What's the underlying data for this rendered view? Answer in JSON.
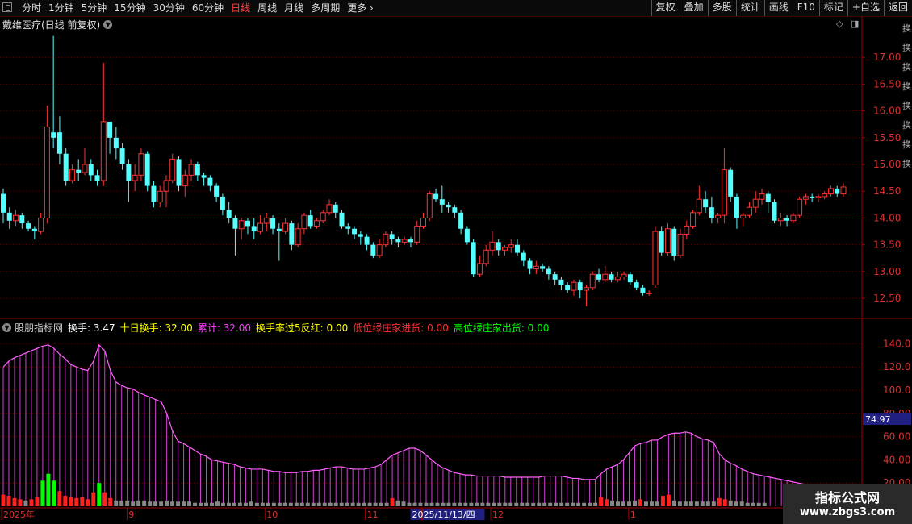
{
  "toolbar": {
    "periods": [
      "分时",
      "1分钟",
      "5分钟",
      "15分钟",
      "30分钟",
      "60分钟",
      "日线",
      "周线",
      "月线",
      "多周期",
      "更多 ›"
    ],
    "active_period": "日线",
    "buttons": [
      "复权",
      "叠加",
      "多股",
      "统计",
      "画线",
      "F10",
      "标记",
      "+自选",
      "返回"
    ]
  },
  "main": {
    "title": "戴维医疗(日线 前复权)",
    "price_ticks": [
      "17.00",
      "16.50",
      "16.00",
      "15.50",
      "15.00",
      "14.50",
      "14.00",
      "13.50",
      "13.00",
      "12.50"
    ]
  },
  "indicator": {
    "name": "股朋指标网",
    "items": [
      {
        "label": "换手: 3.47",
        "color": "#ffffff"
      },
      {
        "label": "十日换手: 32.00",
        "color": "#ffff00"
      },
      {
        "label": "累计: 32.00",
        "color": "#ff40ff"
      },
      {
        "label": "换手率过5反红: 0.00",
        "color": "#ffff00"
      },
      {
        "label": "低位绿庄家进货: 0.00",
        "color": "#ff3030"
      },
      {
        "label": "高位绿庄家出货: 0.00",
        "color": "#00ff00"
      }
    ],
    "ticks": [
      "140.0",
      "120.0",
      "100.0",
      "80.00",
      "60.00",
      "40.00",
      "20.00"
    ],
    "current_value": "74.97"
  },
  "date_axis": {
    "labels": [
      {
        "text": "2025年",
        "i": 0
      },
      {
        "text": "9",
        "i": 20
      },
      {
        "text": "10",
        "i": 42
      },
      {
        "text": "11",
        "i": 58
      },
      {
        "text": "2025/11/13/四",
        "i": 67,
        "highlight": true
      },
      {
        "text": "12",
        "i": 78
      },
      {
        "text": "1",
        "i": 100
      }
    ]
  },
  "side_chars": "换换换换换换换换",
  "watermark": {
    "line1": "指标公式网",
    "line2": "www.zbgs3.com"
  },
  "chart_data": {
    "type": "candlestick",
    "title": "戴维医疗(日线 前复权)",
    "ylim": [
      12.2,
      17.5
    ],
    "up_color": "#ff3232",
    "down_color": "#54ffff",
    "candles": [
      [
        14.45,
        14.1,
        14.55,
        13.9
      ],
      [
        14.1,
        13.95,
        14.2,
        13.8
      ],
      [
        13.95,
        14.05,
        14.15,
        13.85
      ],
      [
        14.05,
        13.9,
        14.1,
        13.8
      ],
      [
        13.9,
        13.8,
        13.95,
        13.75
      ],
      [
        13.8,
        13.75,
        13.85,
        13.6
      ],
      [
        13.75,
        14.0,
        14.1,
        13.7
      ],
      [
        14.0,
        15.7,
        16.1,
        13.9
      ],
      [
        15.6,
        15.5,
        17.4,
        15.3
      ],
      [
        15.6,
        15.2,
        15.9,
        15.0
      ],
      [
        15.2,
        14.7,
        15.3,
        14.6
      ],
      [
        14.7,
        14.9,
        15.0,
        14.65
      ],
      [
        14.9,
        14.85,
        15.1,
        14.7
      ],
      [
        14.85,
        15.0,
        15.3,
        14.8
      ],
      [
        15.0,
        14.8,
        15.1,
        14.7
      ],
      [
        14.8,
        14.7,
        14.9,
        14.6
      ],
      [
        14.7,
        15.8,
        16.9,
        14.6
      ],
      [
        15.8,
        15.5,
        15.6,
        15.2
      ],
      [
        15.5,
        15.3,
        15.7,
        15.1
      ],
      [
        15.3,
        15.0,
        15.4,
        14.9
      ],
      [
        15.0,
        14.7,
        15.1,
        14.3
      ],
      [
        14.7,
        14.8,
        15.0,
        14.5
      ],
      [
        14.8,
        15.2,
        15.3,
        14.7
      ],
      [
        15.2,
        14.6,
        15.25,
        14.5
      ],
      [
        14.6,
        14.3,
        14.7,
        14.2
      ],
      [
        14.3,
        14.5,
        14.6,
        14.2
      ],
      [
        14.5,
        14.7,
        14.8,
        14.2
      ],
      [
        14.7,
        15.1,
        15.2,
        14.65
      ],
      [
        15.1,
        14.6,
        15.15,
        14.5
      ],
      [
        14.6,
        14.8,
        14.9,
        14.4
      ],
      [
        14.8,
        15.0,
        15.1,
        14.7
      ],
      [
        15.0,
        14.8,
        15.05,
        14.7
      ],
      [
        14.8,
        14.75,
        14.85,
        14.6
      ],
      [
        14.75,
        14.6,
        14.8,
        14.5
      ],
      [
        14.6,
        14.4,
        14.65,
        14.3
      ],
      [
        14.4,
        14.15,
        14.45,
        14.05
      ],
      [
        14.15,
        14.0,
        14.3,
        13.9
      ],
      [
        14.0,
        13.8,
        14.05,
        13.3
      ],
      [
        13.8,
        13.95,
        14.0,
        13.6
      ],
      [
        13.95,
        13.85,
        14.0,
        13.7
      ],
      [
        13.85,
        13.75,
        14.0,
        13.6
      ],
      [
        13.75,
        13.9,
        14.05,
        13.7
      ],
      [
        13.9,
        14.0,
        14.1,
        13.75
      ],
      [
        14.0,
        13.8,
        14.05,
        13.7
      ],
      [
        13.8,
        13.75,
        13.9,
        13.2
      ],
      [
        13.75,
        13.9,
        14.0,
        13.7
      ],
      [
        13.9,
        13.5,
        13.95,
        13.4
      ],
      [
        13.5,
        13.8,
        13.9,
        13.45
      ],
      [
        13.8,
        14.05,
        14.1,
        13.7
      ],
      [
        14.05,
        13.85,
        14.15,
        13.8
      ],
      [
        13.85,
        13.95,
        14.0,
        13.8
      ],
      [
        13.95,
        14.1,
        14.15,
        13.9
      ],
      [
        14.1,
        14.25,
        14.35,
        14.05
      ],
      [
        14.25,
        14.1,
        14.3,
        14.0
      ],
      [
        14.1,
        13.85,
        14.15,
        13.8
      ],
      [
        13.85,
        13.8,
        13.9,
        13.7
      ],
      [
        13.8,
        13.7,
        13.85,
        13.6
      ],
      [
        13.7,
        13.65,
        13.75,
        13.5
      ],
      [
        13.65,
        13.5,
        13.7,
        13.4
      ],
      [
        13.5,
        13.3,
        13.55,
        13.25
      ],
      [
        13.3,
        13.5,
        13.6,
        13.25
      ],
      [
        13.5,
        13.7,
        13.75,
        13.45
      ],
      [
        13.7,
        13.6,
        13.75,
        13.5
      ],
      [
        13.6,
        13.55,
        13.65,
        13.45
      ],
      [
        13.55,
        13.6,
        13.65,
        13.5
      ],
      [
        13.6,
        13.55,
        13.65,
        13.45
      ],
      [
        13.55,
        13.85,
        13.95,
        13.5
      ],
      [
        13.85,
        14.0,
        14.1,
        13.8
      ],
      [
        14.0,
        14.45,
        14.5,
        13.95
      ],
      [
        14.45,
        14.35,
        14.55,
        14.3
      ],
      [
        14.35,
        14.25,
        14.6,
        14.1
      ],
      [
        14.25,
        14.2,
        14.3,
        14.1
      ],
      [
        14.2,
        14.1,
        14.25,
        14.0
      ],
      [
        14.1,
        13.8,
        14.15,
        13.7
      ],
      [
        13.8,
        13.55,
        13.85,
        13.5
      ],
      [
        13.55,
        12.95,
        13.6,
        12.9
      ],
      [
        12.95,
        13.15,
        13.3,
        12.9
      ],
      [
        13.15,
        13.4,
        13.5,
        13.1
      ],
      [
        13.4,
        13.55,
        13.75,
        13.3
      ],
      [
        13.55,
        13.4,
        13.6,
        13.3
      ],
      [
        13.4,
        13.45,
        13.5,
        13.3
      ],
      [
        13.45,
        13.5,
        13.6,
        13.35
      ],
      [
        13.5,
        13.35,
        13.6,
        13.3
      ],
      [
        13.35,
        13.2,
        13.4,
        13.1
      ],
      [
        13.2,
        13.05,
        13.25,
        12.95
      ],
      [
        13.05,
        13.1,
        13.2,
        12.95
      ],
      [
        13.1,
        13.05,
        13.15,
        13.0
      ],
      [
        13.05,
        12.95,
        13.1,
        12.85
      ],
      [
        12.95,
        12.85,
        13.0,
        12.75
      ],
      [
        12.85,
        12.75,
        12.9,
        12.65
      ],
      [
        12.75,
        12.65,
        12.8,
        12.6
      ],
      [
        12.65,
        12.8,
        12.85,
        12.55
      ],
      [
        12.8,
        12.65,
        12.85,
        12.5
      ],
      [
        12.65,
        12.7,
        12.75,
        12.35
      ],
      [
        12.7,
        12.95,
        13.0,
        12.65
      ],
      [
        12.95,
        12.85,
        13.05,
        12.8
      ],
      [
        12.85,
        12.95,
        13.1,
        12.8
      ],
      [
        12.95,
        12.85,
        13.0,
        12.8
      ],
      [
        12.85,
        12.9,
        13.0,
        12.8
      ],
      [
        12.9,
        12.95,
        13.0,
        12.85
      ],
      [
        12.95,
        12.8,
        13.0,
        12.75
      ],
      [
        12.8,
        12.7,
        12.85,
        12.65
      ],
      [
        12.7,
        12.6,
        12.75,
        12.55
      ],
      [
        12.6,
        12.6,
        12.65,
        12.55
      ],
      [
        12.75,
        13.75,
        13.85,
        12.7
      ],
      [
        13.75,
        13.35,
        13.85,
        13.3
      ],
      [
        13.35,
        13.8,
        13.9,
        13.3
      ],
      [
        13.8,
        13.3,
        13.85,
        13.2
      ],
      [
        13.3,
        13.7,
        13.8,
        13.25
      ],
      [
        13.7,
        13.85,
        13.95,
        13.6
      ],
      [
        13.85,
        14.1,
        14.15,
        13.8
      ],
      [
        14.1,
        14.35,
        14.6,
        14.05
      ],
      [
        14.35,
        14.2,
        14.5,
        14.1
      ],
      [
        14.2,
        14.0,
        14.4,
        13.9
      ],
      [
        14.0,
        14.05,
        14.1,
        13.9
      ],
      [
        14.05,
        14.9,
        15.3,
        13.9
      ],
      [
        14.9,
        14.4,
        14.95,
        14.3
      ],
      [
        14.4,
        14.0,
        14.45,
        13.8
      ],
      [
        14.0,
        14.05,
        14.1,
        13.85
      ],
      [
        14.05,
        14.2,
        14.3,
        14.0
      ],
      [
        14.2,
        14.35,
        14.5,
        14.1
      ],
      [
        14.35,
        14.45,
        14.55,
        14.25
      ],
      [
        14.45,
        14.3,
        14.5,
        14.1
      ],
      [
        14.3,
        13.95,
        14.35,
        13.9
      ],
      [
        13.95,
        14.0,
        14.1,
        13.85
      ],
      [
        14.0,
        13.95,
        14.05,
        13.85
      ],
      [
        13.95,
        14.05,
        14.1,
        13.9
      ],
      [
        14.05,
        14.35,
        14.4,
        14.0
      ],
      [
        14.35,
        14.4,
        14.45,
        14.25
      ],
      [
        14.4,
        14.38,
        14.45,
        14.3
      ],
      [
        14.38,
        14.4,
        14.45,
        14.3
      ],
      [
        14.4,
        14.45,
        14.5,
        14.35
      ],
      [
        14.45,
        14.55,
        14.6,
        14.4
      ],
      [
        14.55,
        14.45,
        14.6,
        14.4
      ],
      [
        14.45,
        14.58,
        14.65,
        14.4
      ]
    ],
    "turnover_cumulative": [
      120,
      125,
      128,
      130,
      132,
      134,
      136,
      138,
      139,
      136,
      131,
      127,
      122,
      120,
      118,
      117,
      125,
      139,
      134,
      117,
      107,
      104,
      102,
      101,
      98,
      96,
      94,
      92,
      90,
      80,
      65,
      56,
      54,
      51,
      48,
      45,
      43,
      40,
      39,
      38,
      37,
      36,
      34,
      33,
      32,
      32,
      32,
      31,
      30,
      30,
      29,
      29,
      29,
      30,
      30,
      31,
      31,
      32,
      33,
      34,
      34,
      33,
      32,
      32,
      32,
      33,
      34,
      36,
      40,
      44,
      46,
      48,
      50,
      50,
      48,
      44,
      40,
      36,
      33,
      31,
      29,
      28,
      27,
      27,
      26,
      26,
      26,
      26,
      26,
      25,
      25,
      25,
      25,
      25,
      25,
      25,
      26,
      26,
      26,
      26,
      25,
      24,
      24,
      23,
      23,
      23,
      28,
      32,
      34,
      36,
      40,
      46,
      52,
      54,
      55,
      57,
      57,
      60,
      62,
      63,
      63,
      64,
      63,
      60,
      58,
      57,
      55,
      45,
      40,
      37,
      35,
      32,
      30,
      28,
      27,
      26,
      25,
      24,
      23,
      22,
      21,
      20,
      19,
      18,
      17,
      16,
      15,
      14,
      13,
      12
    ],
    "turnover_daily": [
      10,
      9,
      7,
      6,
      5,
      6,
      8,
      22,
      28,
      22,
      13,
      9,
      8,
      7,
      8,
      6,
      12,
      20,
      12,
      7,
      5,
      5,
      5,
      4,
      5,
      5,
      4,
      4,
      4,
      5,
      4,
      4,
      4,
      4,
      3,
      3,
      3,
      3,
      4,
      3,
      3,
      3,
      3,
      3,
      4,
      3,
      3,
      3,
      3,
      3,
      3,
      3,
      3,
      3,
      3,
      3,
      3,
      3,
      3,
      3,
      3,
      3,
      3,
      3,
      3,
      3,
      3,
      3,
      3,
      7,
      5,
      4,
      3,
      3,
      3,
      3,
      3,
      3,
      3,
      3,
      3,
      3,
      3,
      3,
      3,
      3,
      3,
      3,
      3,
      3,
      3,
      3,
      3,
      3,
      3,
      3,
      3,
      3,
      3,
      3,
      3,
      3,
      3,
      3,
      3,
      3,
      8,
      6,
      5,
      4,
      4,
      4,
      5,
      6,
      4,
      4,
      4,
      9,
      10,
      5,
      4,
      4,
      4,
      4,
      4,
      4,
      4,
      7,
      6,
      5,
      4,
      4,
      3,
      3,
      3,
      3
    ],
    "turnover_ylim": [
      0,
      150
    ]
  }
}
